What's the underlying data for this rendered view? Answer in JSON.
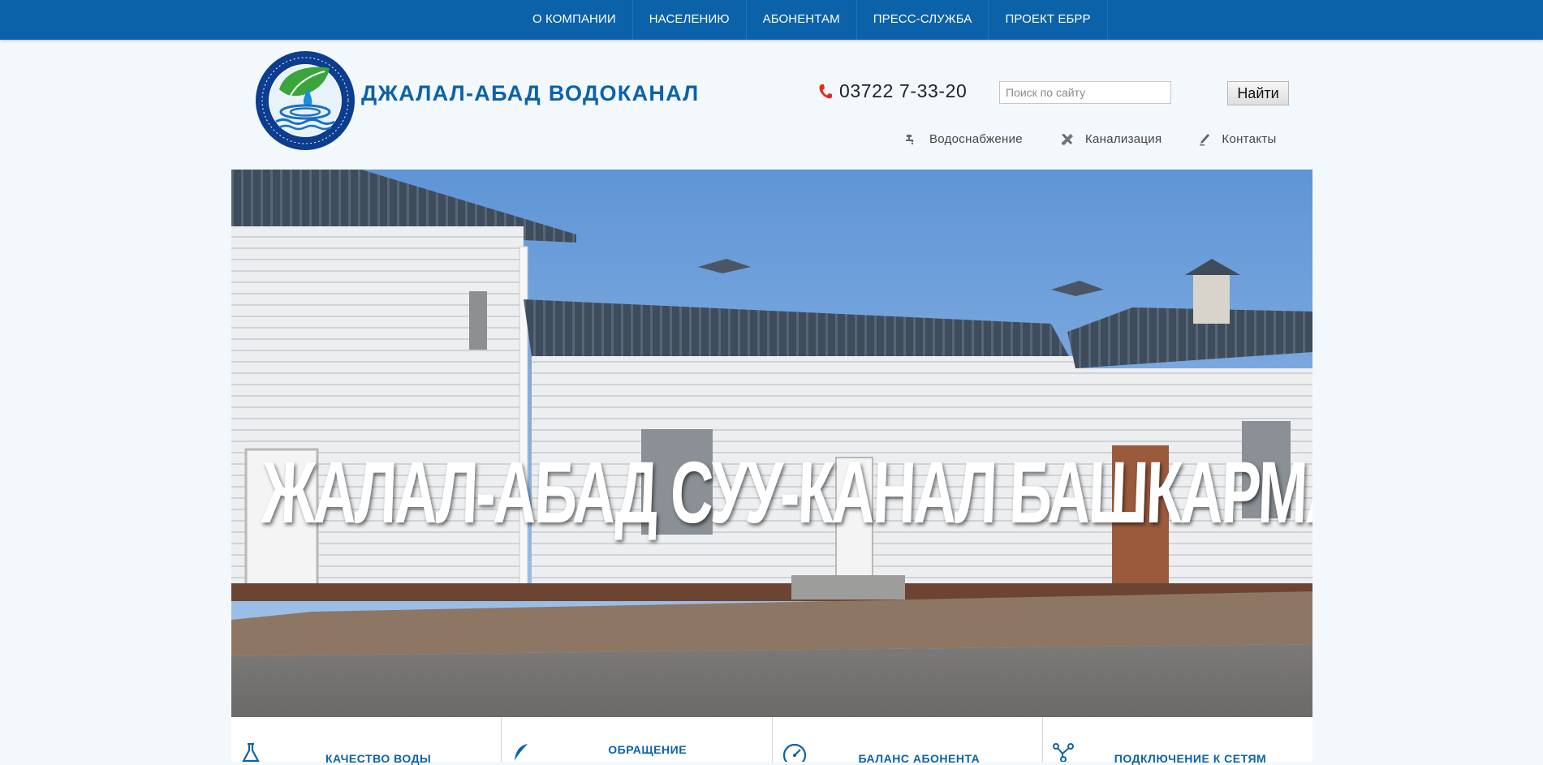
{
  "topnav": {
    "items": [
      "О КОМПАНИИ",
      "НАСЕЛЕНИЮ",
      "АБОНЕНТАМ",
      "ПРЕСС-СЛУЖБА",
      "ПРОЕКТ ЕБРР"
    ]
  },
  "header": {
    "site_name": "ДЖАЛАЛ-АБАД ВОДОКАНАЛ",
    "phone": "03722 7-33-20",
    "search_placeholder": "Поиск по сайту",
    "search_button": "Найти"
  },
  "subnav": {
    "items": [
      {
        "label": "Водоснабжение",
        "icon": "faucet-icon"
      },
      {
        "label": "Канализация",
        "icon": "tools-icon"
      },
      {
        "label": "Контакты",
        "icon": "pen-icon"
      }
    ]
  },
  "banner": {
    "title": "ЖАЛАЛ-АБАД СУУ-КАНАЛ БАШКАРМАЛЫГЫ"
  },
  "features": {
    "items": [
      {
        "label": "КАЧЕСТВО ВОДЫ",
        "icon": "flask-icon"
      },
      {
        "label": "ОБРАЩЕНИЕ",
        "icon": "quill-icon"
      },
      {
        "label": "БАЛАНС АБОНЕНТА",
        "icon": "gauge-icon"
      },
      {
        "label": "ПОДКЛЮЧЕНИЕ К СЕТЯМ",
        "icon": "network-icon"
      }
    ]
  },
  "colors": {
    "brand_blue": "#0b62a9",
    "phone_icon": "#e02b20"
  }
}
